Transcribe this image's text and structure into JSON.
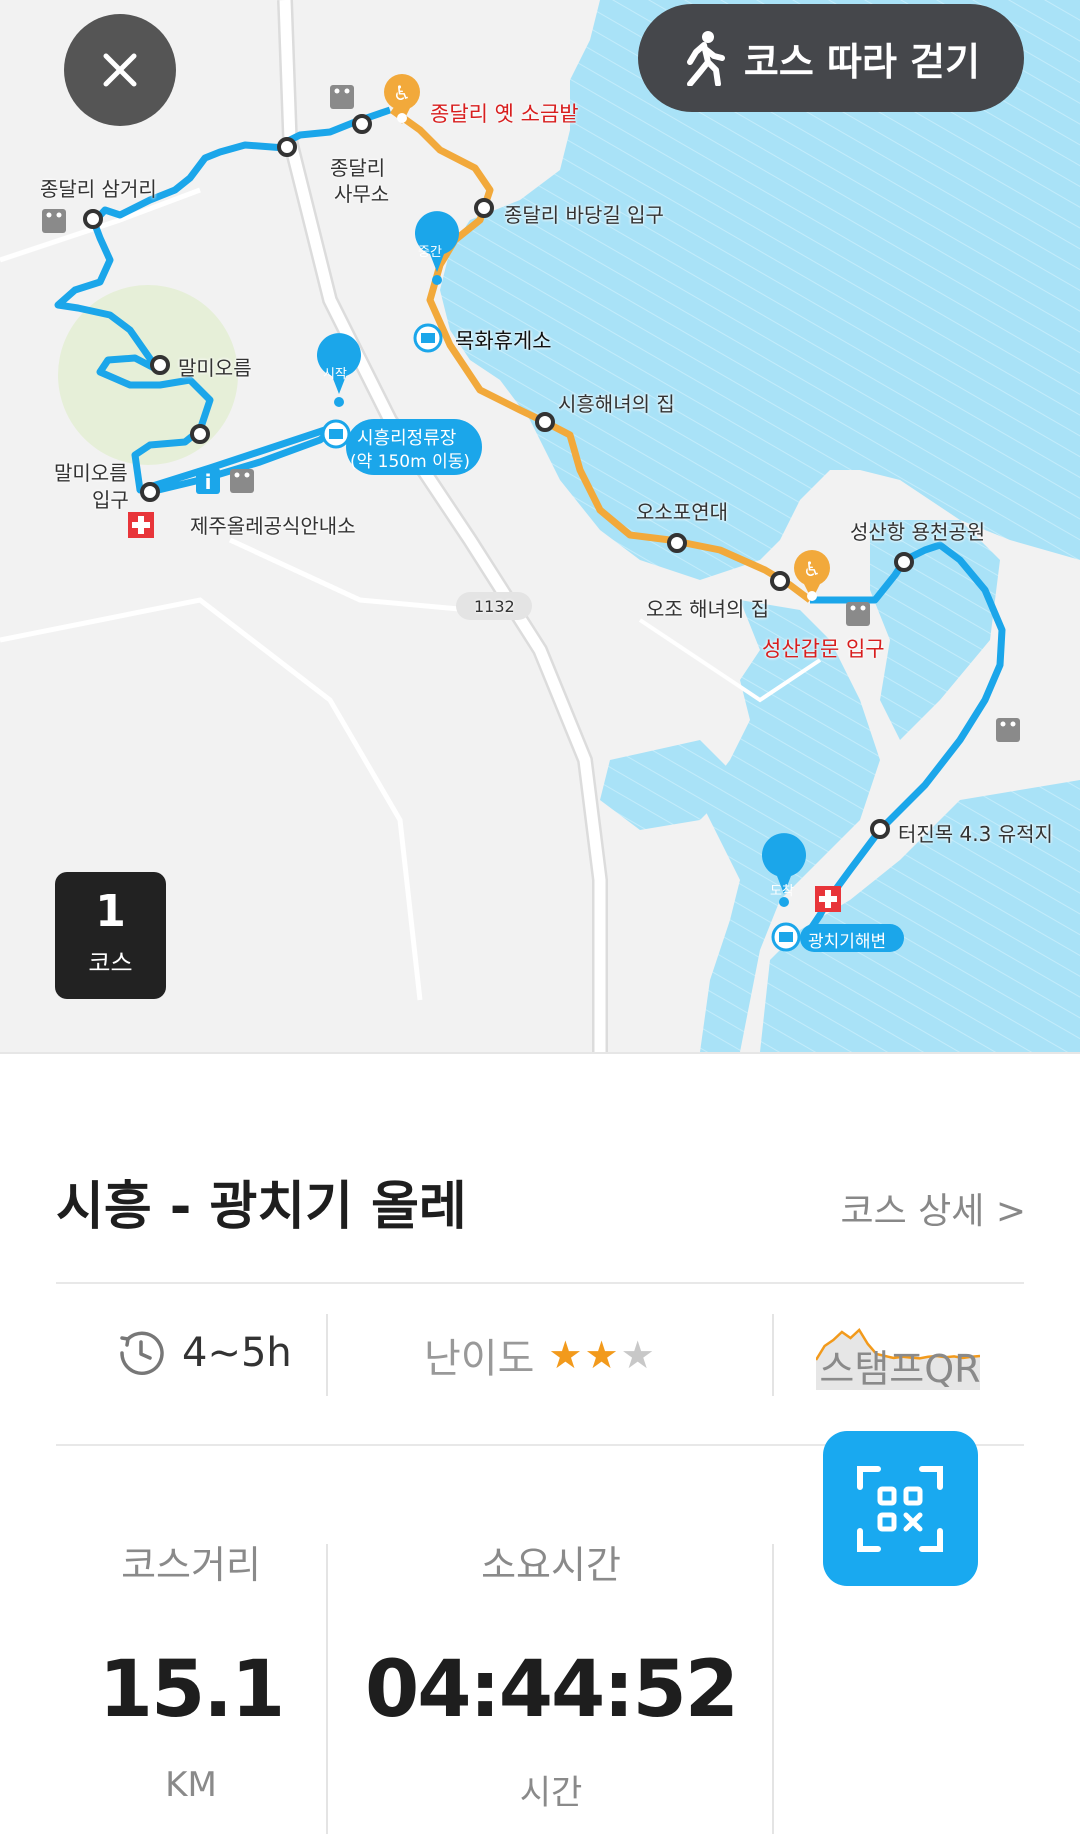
{
  "header": {
    "close_icon": "close-icon",
    "follow_button_label": "코스 따라 걷기",
    "follow_icon": "walking-person-icon"
  },
  "course_badge": {
    "number": "1",
    "label": "코스"
  },
  "map": {
    "colors": {
      "sea": "#a9e2f7",
      "land": "#f2f2f2",
      "road": "#ffffff",
      "route_blue": "#1ba6ea",
      "route_orange": "#f2a93b"
    },
    "labels": {
      "jongdal_saltfield": "종달리 옛 소금밭",
      "jongdal_office_l1": "종달리",
      "jongdal_office_l2": "사무소",
      "jongdal_junction": "종달리 삼거리",
      "jongdal_seaside": "종달리 바당길 입구",
      "middle_pin": "중간",
      "mokhwa_rest": "목화휴게소",
      "malmi_oreum": "말미오름",
      "start_pin": "시작",
      "siheung_stop_l1": "시흥리정류장",
      "siheung_stop_l2": "(약 150m 이동)",
      "malmi_entrance_l1": "말미오름",
      "malmi_entrance_l2": "입구",
      "info_center": "제주올레공식안내소",
      "siheung_haenyeo": "시흥해녀의 집",
      "osopo": "오소포연대",
      "road_number": "1132",
      "seongsan_park": "성산항 용천공원",
      "ojo_haenyeo": "오조 해녀의 집",
      "seongsan_gate": "성산갑문 입구",
      "teojinmok": "터진목 4.3 유적지",
      "end_pin": "도착",
      "gwangchigi_beach": "광치기해변"
    }
  },
  "course": {
    "title": "시흥 - 광치기 올레",
    "detail_link": "코스 상세 >",
    "estimated_time": "4~5h",
    "difficulty_label": "난이도",
    "difficulty_rating": 2,
    "difficulty_max": 3,
    "elevation_profile": [
      0.2,
      0.55,
      0.7,
      0.9,
      0.75,
      0.95,
      0.6,
      0.35,
      0.3,
      0.25,
      0.28,
      0.26,
      0.24,
      0.28,
      0.3,
      0.27,
      0.29,
      0.25,
      0.28,
      0.3
    ]
  },
  "stats": {
    "distance_label": "코스거리",
    "distance_value": "15.1",
    "distance_unit": "KM",
    "duration_label": "소요시간",
    "duration_value": "04:44:52",
    "duration_unit": "시간",
    "qr_label": "스탬프QR",
    "qr_icon": "qr-scan-icon"
  }
}
